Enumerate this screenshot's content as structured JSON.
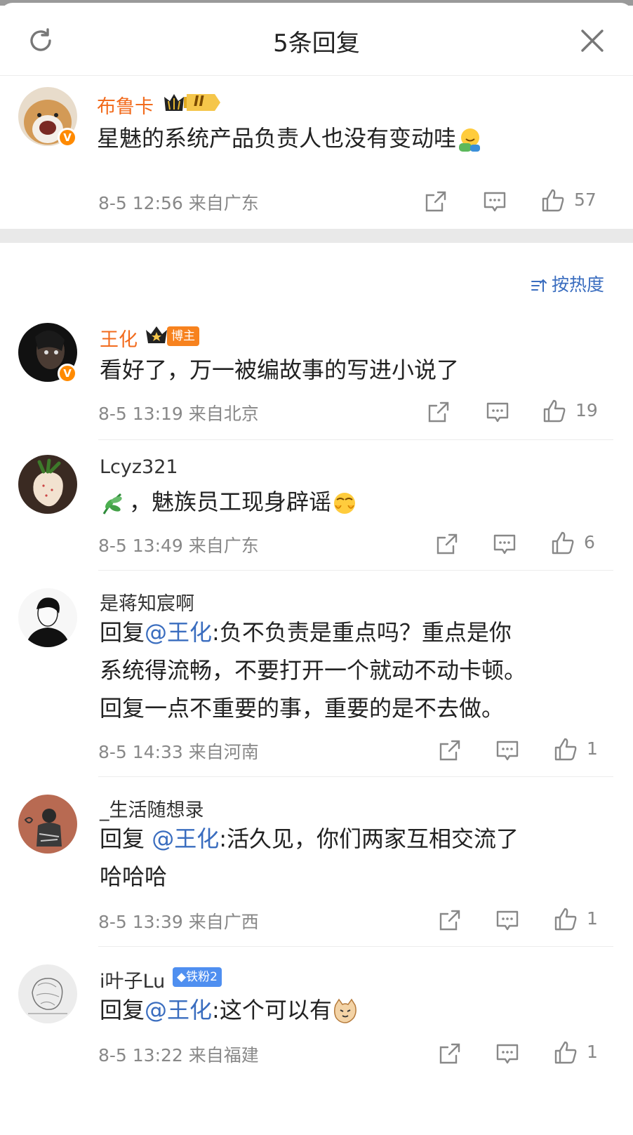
{
  "header": {
    "title": "5条回复",
    "refresh_icon": "refresh-icon",
    "close_icon": "close-icon"
  },
  "root": {
    "username": "布鲁卡",
    "level_badge": "II",
    "text": "星魅的系统产品负责人也没有变动哇",
    "time": "8-5 12:56",
    "location": "来自广东",
    "likes": "57"
  },
  "sort_label": "按热度",
  "replies": [
    {
      "username": "王化",
      "tag": "博主",
      "lines": [
        "看好了，万一被编故事的写进小说了"
      ],
      "time": "8-5 13:19",
      "location": "来自北京",
      "likes": "19"
    },
    {
      "username": "Lcyz321",
      "text_pre": "，魅族员工现身辟谣",
      "time": "8-5 13:49",
      "location": "来自广东",
      "likes": "6"
    },
    {
      "username": "是蒋知宸啊",
      "reply_prefix": "回复",
      "mention": "@王化",
      "line1_rest": ":负不负责是重点吗？重点是你",
      "line2": "系统得流畅，不要打开一个就动不动卡顿。",
      "line3": "回复一点不重要的事，重要的是不去做。",
      "time": "8-5 14:33",
      "location": "来自河南",
      "likes": "1"
    },
    {
      "username": "_生活随想录",
      "reply_prefix": "回复 ",
      "mention": "@王化",
      "line1_rest": ":活久见，你们两家互相交流了",
      "line2": "哈哈哈",
      "time": "8-5 13:39",
      "location": "来自广西",
      "likes": "1"
    },
    {
      "username": "i叶子Lu",
      "tag": "铁粉2",
      "reply_prefix": "回复",
      "mention": "@王化",
      "line1_rest": ":这个可以有",
      "time": "8-5 13:22",
      "location": "来自福建",
      "likes": "1"
    }
  ],
  "colors": {
    "accent_orange": "#f26b1d",
    "link_blue": "#3a6dbf",
    "meta_gray": "#888888"
  }
}
